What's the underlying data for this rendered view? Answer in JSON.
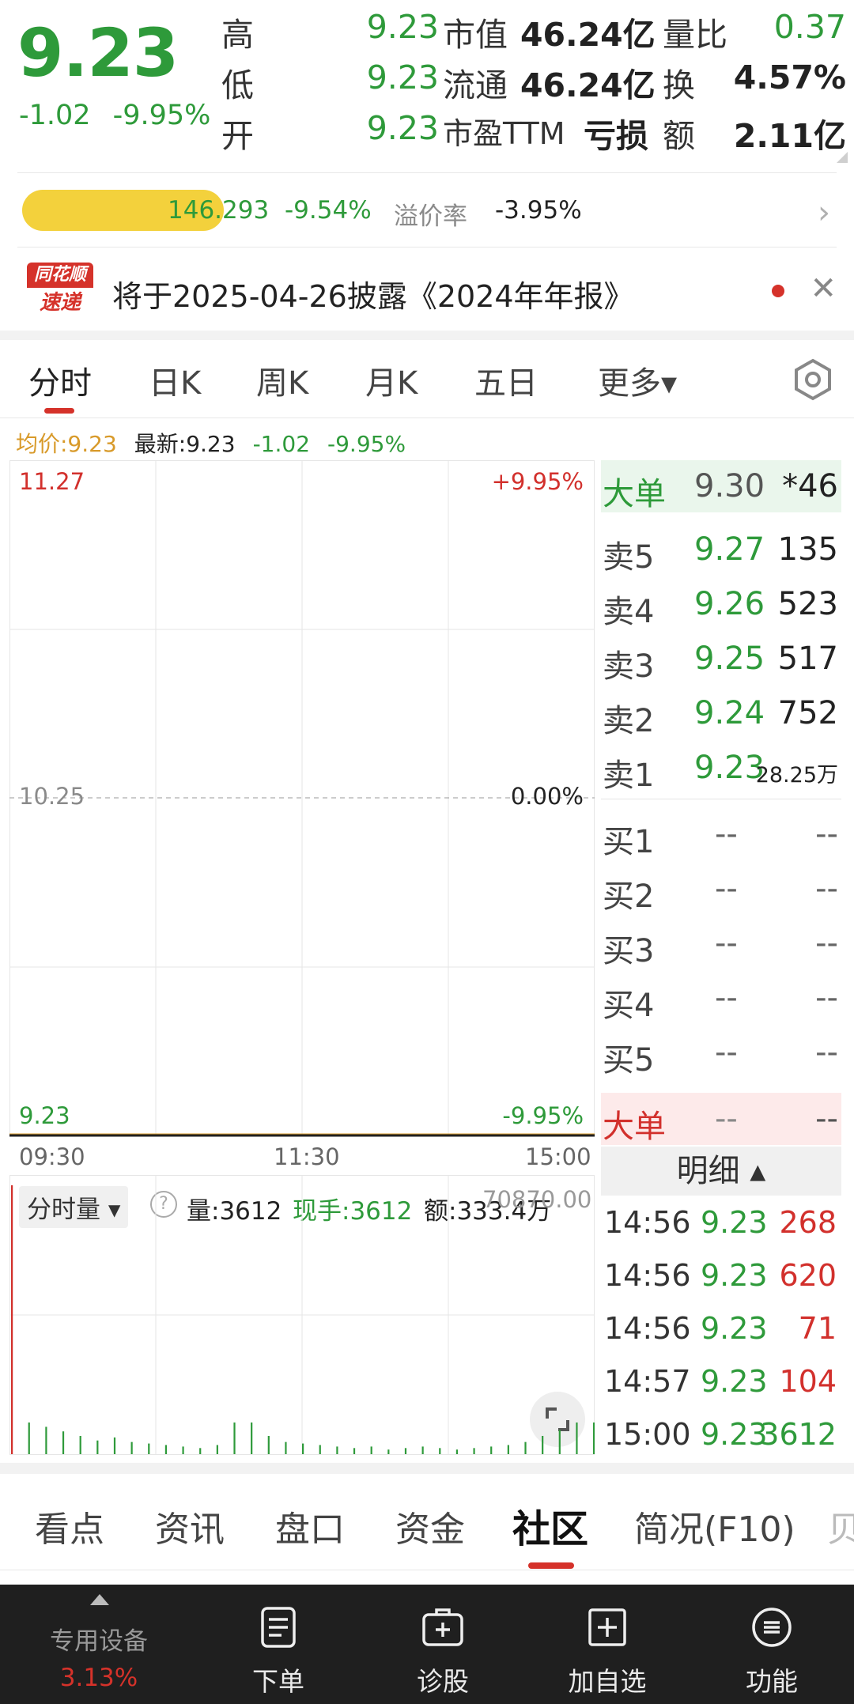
{
  "quote": {
    "price": "9.23",
    "change": "-1.02",
    "change_pct": "-9.95%",
    "rows": [
      {
        "l1": "高",
        "v1": "9.23",
        "l2": "市值",
        "v2": "46.24亿",
        "l3": "量比",
        "v3": "0.37"
      },
      {
        "l1": "低",
        "v1": "9.23",
        "l2": "流通",
        "v2": "46.24亿",
        "l3": "换",
        "v3": "4.57%"
      },
      {
        "l1": "开",
        "v1": "9.23",
        "l2": "市盈TTM",
        "v2": "亏损",
        "l3": "额",
        "v3": "2.11亿"
      }
    ]
  },
  "etf": {
    "value": "146.293",
    "change_pct": "-9.54%",
    "premium_label": "溢价率",
    "premium_value": "-3.95%"
  },
  "notice": {
    "logo_top": "同花顺",
    "logo_bottom": "速递",
    "text": "将于2025-04-26披露《2024年年报》"
  },
  "tabs": [
    "分时",
    "日K",
    "周K",
    "月K",
    "五日",
    "更多▾"
  ],
  "info_line": {
    "avg": "均价:9.23",
    "latest": "最新:9.23",
    "change": "-1.02",
    "change_pct": "-9.95%"
  },
  "chart_data": {
    "type": "line",
    "y_labels_left": [
      "11.27",
      "10.25",
      "9.23"
    ],
    "y_labels_right": [
      "+9.95%",
      "0.00%",
      "-9.95%"
    ],
    "ylim": [
      9.23,
      11.27
    ],
    "x_labels": [
      "09:30",
      "11:30",
      "15:00"
    ],
    "price_series": {
      "name": "价格",
      "value": 9.23
    },
    "avg_series": {
      "name": "均价",
      "value": 9.23
    },
    "volume_max_label": "70870.00",
    "volume_bars": [
      70870,
      2400,
      1800,
      1500,
      1200,
      900,
      1100,
      800,
      700,
      600,
      500,
      400,
      600,
      3200,
      6900,
      1200,
      800,
      700,
      600,
      500,
      400,
      500,
      300,
      400,
      500,
      400,
      300,
      400,
      500,
      600,
      800,
      1200,
      1600,
      2400,
      3612
    ]
  },
  "volume": {
    "selector": "分时量 ▾",
    "help": "?",
    "vol": "量:3612",
    "now_hand": "现手:3612",
    "amount": "额:333.4万"
  },
  "book": {
    "big_top": {
      "label": "大单",
      "price": "9.30",
      "vol": "*46"
    },
    "sells": [
      {
        "label": "卖5",
        "price": "9.27",
        "vol": "135"
      },
      {
        "label": "卖4",
        "price": "9.26",
        "vol": "523"
      },
      {
        "label": "卖3",
        "price": "9.25",
        "vol": "517"
      },
      {
        "label": "卖2",
        "price": "9.24",
        "vol": "752"
      },
      {
        "label": "卖1",
        "price": "9.23",
        "vol": "28.25万"
      }
    ],
    "buys": [
      {
        "label": "买1",
        "price": "--",
        "vol": "--"
      },
      {
        "label": "买2",
        "price": "--",
        "vol": "--"
      },
      {
        "label": "买3",
        "price": "--",
        "vol": "--"
      },
      {
        "label": "买4",
        "price": "--",
        "vol": "--"
      },
      {
        "label": "买5",
        "price": "--",
        "vol": "--"
      }
    ],
    "big_bottom": {
      "label": "大单",
      "price": "--",
      "vol": "--"
    }
  },
  "detail": {
    "header": "明细 ▴",
    "trades": [
      {
        "time": "14:56",
        "price": "9.23",
        "vol": "268"
      },
      {
        "time": "14:56",
        "price": "9.23",
        "vol": "620"
      },
      {
        "time": "14:56",
        "price": "9.23",
        "vol": "71"
      },
      {
        "time": "14:57",
        "price": "9.23",
        "vol": "104"
      },
      {
        "time": "15:00",
        "price": "9.23",
        "vol": "3612"
      }
    ]
  },
  "bottom_tabs": [
    "看点",
    "资讯",
    "盘口",
    "资金",
    "社区",
    "简况(F10)",
    "贝"
  ],
  "nav": {
    "sector_name": "专用设备",
    "sector_pct": "3.13%",
    "items": [
      {
        "label": "下单",
        "icon": "order-icon"
      },
      {
        "label": "诊股",
        "icon": "diagnose-icon"
      },
      {
        "label": "加自选",
        "icon": "add-watchlist-icon"
      },
      {
        "label": "功能",
        "icon": "menu-icon"
      }
    ]
  },
  "colors": {
    "up": "#d2302c",
    "down": "#2e9a3a",
    "accent": "#d5322a",
    "avg": "#d89a2a"
  }
}
